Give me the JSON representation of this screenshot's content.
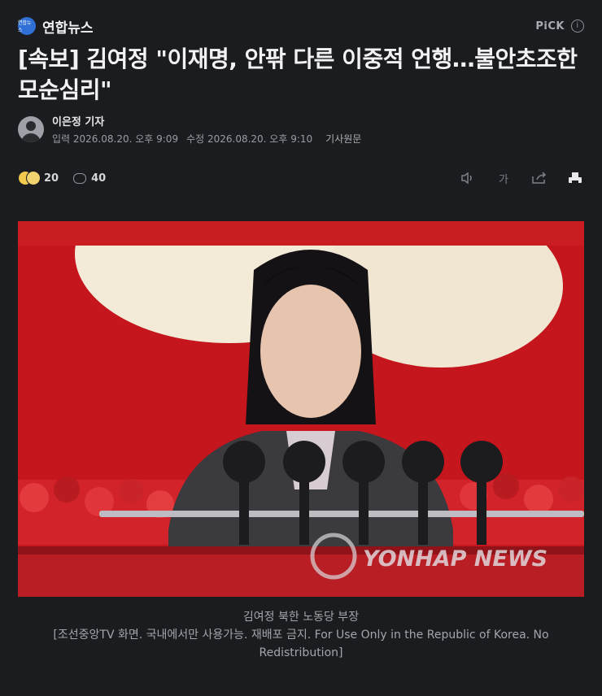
{
  "press": {
    "logo_text": "연합뉴스",
    "name": "연합뉴스"
  },
  "pick": {
    "label": "PiCK",
    "info_icon": "info-icon"
  },
  "headline": "[속보] 김여정 \"이재명, 안팎 다른 이중적 언행…불안초조한 모순심리\"",
  "byline": {
    "reporter": "이은정 기자",
    "published": "입력 2026.08.20. 오후 9:09",
    "modified": "수정 2026.08.20. 오후 9:10",
    "original_link": "기사원문"
  },
  "actions": {
    "reaction_count": "20",
    "comment_count": "40",
    "font_size_label": "가"
  },
  "photo": {
    "watermark": "YONHAP NEWS"
  },
  "caption": {
    "line1": "김여정 북한 노동당 부장",
    "line2": "[조선중앙TV 화면. 국내에서만 사용가능. 재배포 금지. For Use Only in the Republic of Korea. No Redistribution]"
  }
}
